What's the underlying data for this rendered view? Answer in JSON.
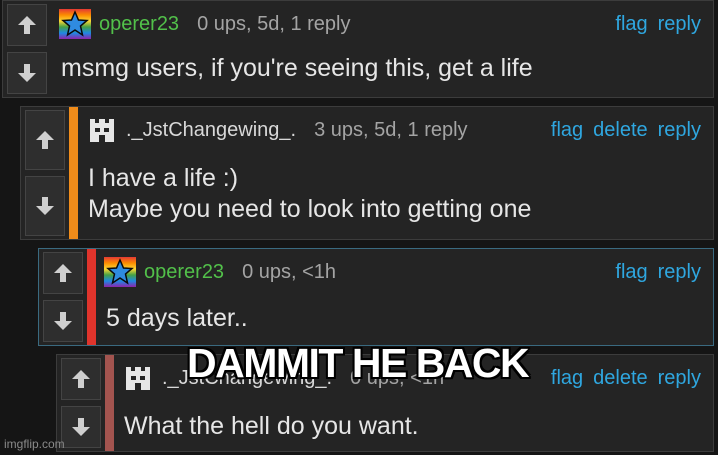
{
  "comments": [
    {
      "username": "operer23",
      "stats": "0 ups, 5d, 1 reply",
      "actions": [
        "flag",
        "reply"
      ],
      "lines": [
        "msmg users, if you're seeing this, get a life"
      ],
      "bar_color": null,
      "avatar": "rainbow-star-icon",
      "username_color": "#52c04a"
    },
    {
      "username": "._JstChangewing_.",
      "stats": "3 ups, 5d, 1 reply",
      "actions": [
        "flag",
        "delete",
        "reply"
      ],
      "lines": [
        "I have a life :)",
        "Maybe you need to look into getting one"
      ],
      "bar_color": "#f08c1a",
      "avatar": "castle-icon",
      "username_color": "#d8d8d8"
    },
    {
      "username": "operer23",
      "stats": "0 ups, <1h",
      "actions": [
        "flag",
        "reply"
      ],
      "lines": [
        "5 days later.."
      ],
      "bar_color": "#e0342c",
      "avatar": "rainbow-star-icon",
      "username_color": "#52c04a"
    },
    {
      "username": "._JstChangewing_.",
      "stats": "0 ups, <1h",
      "actions": [
        "flag",
        "delete",
        "reply"
      ],
      "lines": [
        "What the hell do you want."
      ],
      "bar_color": "#a3544f",
      "avatar": "castle-icon",
      "username_color": "#d8d8d8"
    }
  ],
  "overlay_caption": "DAMMIT HE BACK",
  "watermark": "imgflip.com",
  "colors": {
    "background": "#151515",
    "panel": "#242424",
    "link": "#2fa7e0"
  }
}
